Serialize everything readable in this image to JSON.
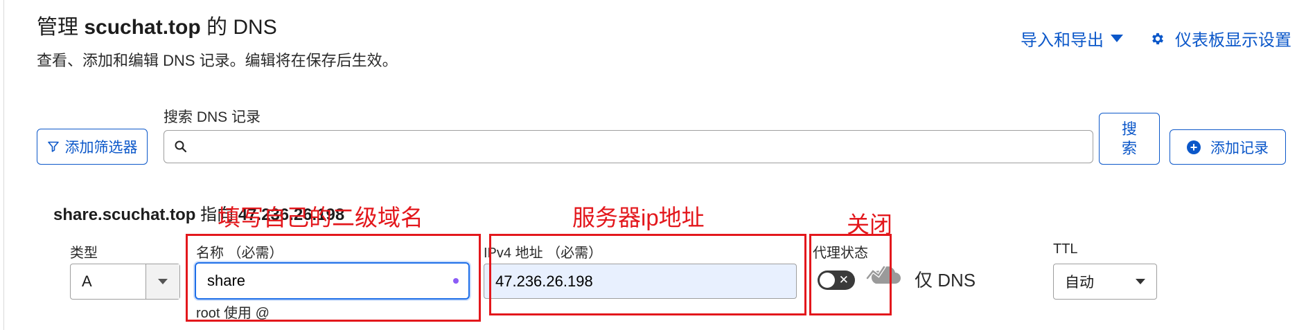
{
  "header": {
    "title_prefix": "管理 ",
    "title_domain": "scuchat.top",
    "title_suffix": " 的 DNS",
    "subtitle": "查看、添加和编辑 DNS 记录。编辑将在保存后生效。",
    "import_export_label": "导入和导出",
    "dashboard_settings_label": "仪表板显示设置"
  },
  "toolbar": {
    "search_label": "搜索 DNS 记录",
    "filter_button_label": "添加筛选器",
    "search_input_value": "",
    "search_button_line1": "搜",
    "search_button_line2": "索",
    "add_record_label": "添加记录"
  },
  "record": {
    "heading_name": "share.scuchat.top",
    "heading_middle": " 指向 ",
    "heading_ip": "47.236.26.198",
    "type": {
      "label": "类型",
      "value": "A"
    },
    "name": {
      "label": "名称 （必需）",
      "value": "share",
      "hint": "root 使用 @"
    },
    "ipv4": {
      "label": "IPv4 地址 （必需）",
      "value": "47.236.26.198"
    },
    "proxy": {
      "label": "代理状态",
      "enabled": false,
      "toggle_glyph": "✕",
      "status_text": "仅 DNS"
    },
    "ttl": {
      "label": "TTL",
      "value": "自动"
    }
  },
  "annotations": {
    "name_note": "填写自己的二级域名",
    "ipv4_note": "服务器ip地址",
    "proxy_note": "关闭",
    "color": "#e3171c"
  },
  "colors": {
    "accent": "#0b57c9",
    "focus": "#1d6ee8",
    "autofill_bg": "#e8f0fe"
  },
  "icons": {
    "filter": "filter-icon",
    "search": "search-icon",
    "gear": "gear-icon",
    "plus": "plus-circle-icon",
    "cloud": "dns-only-cloud-icon"
  }
}
